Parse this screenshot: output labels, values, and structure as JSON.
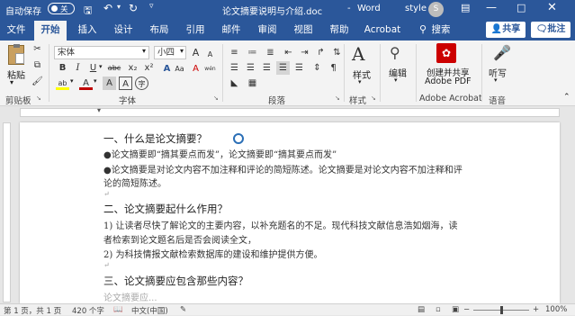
{
  "titlebar": {
    "autosave_label": "自动保存",
    "toggle_state": "关",
    "doc_title": "论文摘要说明与介绍.doc",
    "dash": "-",
    "app_name": "Word",
    "user_name": "style",
    "avatar_initial": "S"
  },
  "tabs": [
    "文件",
    "开始",
    "插入",
    "设计",
    "布局",
    "引用",
    "邮件",
    "审阅",
    "视图",
    "帮助",
    "Acrobat"
  ],
  "search": {
    "label": "搜索"
  },
  "share": {
    "label": "共享"
  },
  "comments": {
    "label": "批注"
  },
  "clipboard": {
    "paste_label": "粘贴",
    "group_label": "剪贴板"
  },
  "font": {
    "name": "宋体",
    "size": "小四",
    "group_label": "字体",
    "grow": "A",
    "shrink": "A",
    "case": "Aa",
    "clear": "A",
    "phonetic": "wén",
    "border_char": "A",
    "bold": "B",
    "italic": "I",
    "underline": "U",
    "strike": "abc",
    "subscript": "x₂",
    "superscript": "x²",
    "effects": "A",
    "highlight": "ab",
    "color": "A",
    "shade": "A",
    "circle": "字"
  },
  "paragraph": {
    "group_label": "段落"
  },
  "styles": {
    "label": "样式",
    "group_label": "样式"
  },
  "editing": {
    "label": "编辑"
  },
  "acrobat": {
    "label_line1": "创建并共享",
    "label_line2": "Adobe PDF",
    "group_label": "Adobe Acrobat"
  },
  "voice": {
    "label": "听写",
    "group_label": "语音"
  },
  "document": {
    "lines": [
      "一、什么是论文摘要？",
      "●论文摘要即“摘其要点而发”，论文摘要即“摘其要点而发”",
      "●论文摘要是对论文内容不加注释和评论的简短陈述。论文摘要是对论文内容不加注释和评",
      "论的简短陈述。",
      "",
      "二、论文摘要起什么作用？",
      "1) 让读者尽快了解论文的主要内容，以补充题名的不足。现代科技文献信息浩如烟海，读",
      "者检索到论文题名后是否会阅读全文，",
      "2) 为科技情报文献检索数据库的建设和维护提供方便。",
      "",
      "三、论文摘要应包含那些内容？",
      "论文摘要应..."
    ]
  },
  "statusbar": {
    "page": "第 1 页，共 1 页",
    "words": "420 个字",
    "language": "中文(中国)",
    "zoom": "100%"
  }
}
